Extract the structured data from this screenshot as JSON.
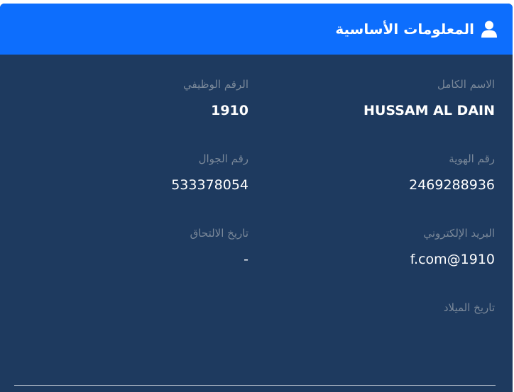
{
  "header": {
    "title": "المعلومات الأساسية",
    "icon": "user-icon",
    "background": "#0d6efd"
  },
  "card": {
    "background": "#1e3a5f"
  },
  "fields": {
    "full_name": {
      "label": "الاسم الكامل",
      "value": "HUSSAM AL DAIN"
    },
    "employee_id": {
      "label": "الرقم الوظيفي",
      "value": "1910"
    },
    "national_id": {
      "label": "رقم الهوية",
      "value": "2469288936"
    },
    "mobile": {
      "label": "رقم الجوال",
      "value": "533378054"
    },
    "email": {
      "label": "البريد الإلكتروني",
      "value": "f.com@1910"
    },
    "join_date": {
      "label": "تاريخ الالتحاق",
      "value": "-"
    },
    "birth_date": {
      "label": "تاريخ الميلاد",
      "value": ""
    }
  }
}
